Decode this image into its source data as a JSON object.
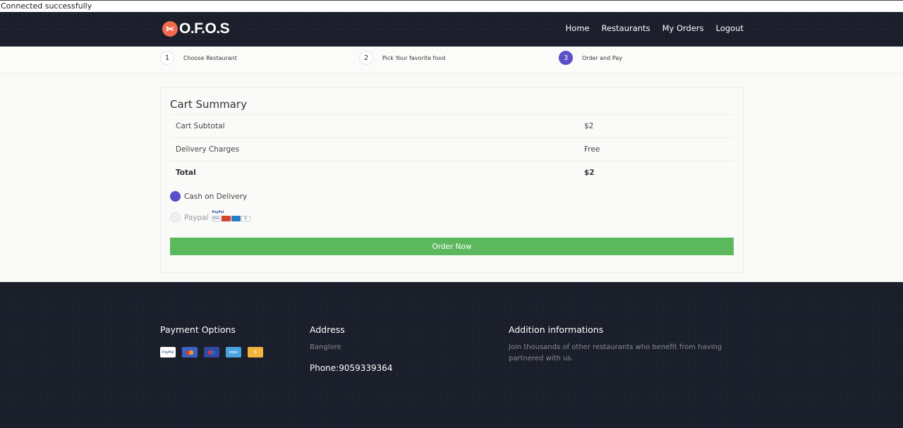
{
  "status_bar": {
    "text": "Connected successfully"
  },
  "navbar": {
    "logo_text": "O.F.O.S",
    "logo_icon": "fork-knife-icon",
    "links": [
      "Home",
      "Restaurants",
      "My Orders",
      "Logout"
    ]
  },
  "steps": [
    {
      "num": "1",
      "label": "Choose Restaurant"
    },
    {
      "num": "2",
      "label": "Pick Your favorite food"
    },
    {
      "num": "3",
      "label": "Order and Pay"
    }
  ],
  "cart": {
    "title": "Cart Summary",
    "rows": [
      {
        "label": "Cart Subtotal",
        "value": "$2"
      },
      {
        "label": "Delivery Charges",
        "value": "Free"
      },
      {
        "label": "Total",
        "value": "$2"
      }
    ],
    "payment": [
      {
        "label": "Cash on Delivery",
        "selected": true
      },
      {
        "label": "Paypal",
        "selected": false,
        "badges": [
          "VISA",
          "MC",
          "AMEX",
          "DISCOVER"
        ],
        "badge_brand": "PayPal"
      }
    ],
    "order_button": "Order Now",
    "colors": {
      "accent": "#5a4fc5",
      "order_button": "#5cb85c",
      "dark": "#1b1f2b"
    }
  },
  "footer": {
    "payment_title": "Payment Options",
    "payment_cards": [
      "PayPal",
      "mastercard",
      "maestro",
      "stripe",
      "bitcoin"
    ],
    "address_title": "Address",
    "address": "Banglore",
    "phone": "Phone:9059339364",
    "info_title": "Addition informations",
    "info_text": "Join thousands of other restaurants who benefit from having partnered with us."
  }
}
